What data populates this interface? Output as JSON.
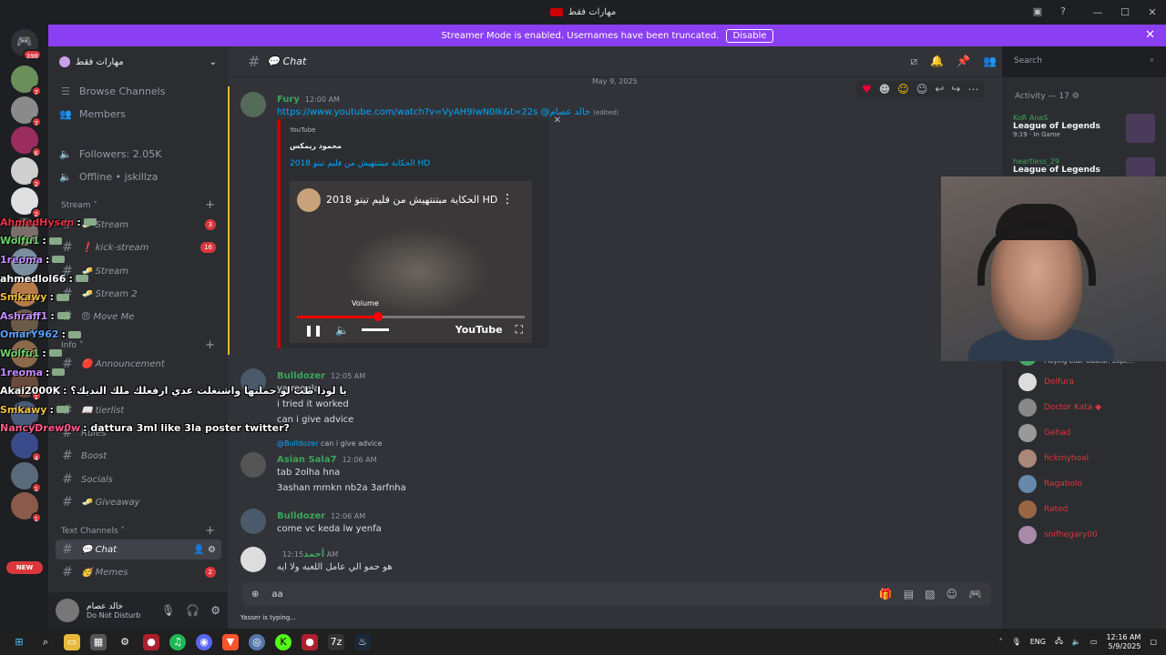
{
  "window": {
    "title": "مهارات فقط",
    "controls": [
      "—",
      "☐",
      "✕"
    ]
  },
  "banner": {
    "text": "Streamer Mode is enabled. Usernames have been truncated.",
    "disable_label": "Disable"
  },
  "guilds": {
    "home_badge": "398",
    "items": [
      {
        "badge": "7",
        "color": "#6a8f5a"
      },
      {
        "badge": "7",
        "color": "#8a8a8a"
      },
      {
        "badge": "6",
        "color": "#9b2c5e"
      },
      {
        "badge": "2",
        "color": "#cfcfcf"
      },
      {
        "badge": "2",
        "color": "#e0e0e0"
      },
      {
        "badge": "",
        "color": "#7a6f6a"
      },
      {
        "badge": "",
        "color": "#7a8fa0"
      },
      {
        "badge": "",
        "color": "#b57c4a"
      },
      {
        "badge": "",
        "color": "#6a5a4a"
      },
      {
        "badge": "",
        "color": "#8a6a4a"
      },
      {
        "badge": "1",
        "color": "#6a4a3a"
      },
      {
        "badge": "1",
        "color": "#4a5a7a"
      },
      {
        "badge": "4",
        "color": "#3a4a8a"
      },
      {
        "badge": "1",
        "color": "#5a6a7a"
      },
      {
        "badge": "1",
        "color": "#8a5a4a"
      }
    ],
    "new_label": "NEW"
  },
  "sidebar": {
    "server_name": "مهارات فقط",
    "browse": "Browse Channels",
    "members": "Members",
    "followers": "Followers: 2.05K",
    "offline": "Offline • jskillza",
    "cat_stream": "Stream ˅",
    "cat_info": "Info ˅",
    "cat_text": "Text Channels ˅",
    "channels": [
      {
        "name": "🧈 Stream",
        "count": "3"
      },
      {
        "name": "❗ kick-stream",
        "count": "16"
      },
      {
        "name": "🧈 Stream",
        "count": ""
      },
      {
        "name": "🧈 Stream 2",
        "count": ""
      },
      {
        "name": "😠 Move Me",
        "count": ""
      },
      {
        "name": "🔴 Announcement",
        "count": ""
      },
      {
        "name": "📖 tierlist",
        "count": ""
      },
      {
        "name": "Rules",
        "count": ""
      },
      {
        "name": "Boost",
        "count": ""
      },
      {
        "name": "Socials",
        "count": ""
      },
      {
        "name": "🧈 Giveaway",
        "count": ""
      },
      {
        "name": "💬 Chat",
        "count": ""
      },
      {
        "name": "🥳 Memes",
        "count": "2"
      }
    ],
    "user": {
      "name": "خالد عصام",
      "status": "Do Not Disturb"
    }
  },
  "header": {
    "channel": "💬 Chat",
    "search_placeholder": "Search"
  },
  "chat": {
    "date": "May 9, 2025",
    "messages": [
      {
        "author": "Fury",
        "time": "12:00 AM",
        "color": "#3ba55c",
        "link": "https://www.youtube.com/watch?v=VyAH9IwN0Ik&t=22s",
        "mention": "@خالد عصام",
        "edited": "(edited)"
      },
      {
        "author": "Bulldozer",
        "time": "12:05 AM",
        "color": "#3ba55c",
        "lines": [
          "ya regala",
          "i tried it worked",
          "can i give advice"
        ]
      },
      {
        "author": "Asian Sala7",
        "time": "12:06 AM",
        "color": "#3ba55c",
        "lines": [
          "tab 2olha hna",
          "3ashan mmkn nb2a 3arfnha"
        ]
      },
      {
        "author": "Bulldozer",
        "time": "12:06 AM",
        "color": "#3ba55c",
        "lines": [
          "come vc keda lw yenfa"
        ]
      },
      {
        "author": "أحمد",
        "time": "12:15 AM",
        "color": "#3ba55c",
        "lines": [
          "هو حمو الي عامل اللعبه ولا ايه"
        ]
      }
    ],
    "reply_ref": {
      "name": "@Bulldozer",
      "text": "can i give advice"
    },
    "embed": {
      "provider": "YouTube",
      "author": "محمود ريمكس",
      "title": "الحكاية مبتنتهيش من فليم تيتو 2018 HD",
      "video_title": "الحكاية مبتنتهيش من فليم تيتو 2018 HD",
      "volume_label": "Volume",
      "yt_label": "YouTube",
      "progress": 0.35
    },
    "composer_text": "aa",
    "typing": "Yasser is typing..."
  },
  "members": {
    "activity_head": "Activity — 17 ⚙",
    "activities": [
      {
        "name": "KoR AnaS",
        "game": "League of Legends",
        "status": "9:19 · In Game"
      },
      {
        "name": "heartless_29",
        "game": "League of Legends",
        "status": ""
      }
    ],
    "list": [
      {
        "name": "Biskoo",
        "status": "mansourabuff"
      },
      {
        "name": "Cipher",
        "status": ""
      },
      {
        "name": "Darkpharaoh",
        "status": "Playing Clair Obscur: Expe..."
      },
      {
        "name": "Delfura",
        "status": ""
      },
      {
        "name": "Doctor Kata ◆",
        "status": ""
      },
      {
        "name": "Gehad",
        "status": ""
      },
      {
        "name": "fickmyhoal",
        "status": ""
      },
      {
        "name": "Ragabolo",
        "status": ""
      },
      {
        "name": "Rated",
        "status": ""
      },
      {
        "name": "soifhegary00",
        "status": ""
      }
    ]
  },
  "overlay": [
    {
      "user": "AhmedHysen",
      "color": "#e8334a",
      "msg": ":"
    },
    {
      "user": "Wolfu1",
      "color": "#6dd36d",
      "msg": ":"
    },
    {
      "user": "1reoma",
      "color": "#c58cff",
      "msg": ":"
    },
    {
      "user": "ahmedlol66",
      "color": "#ffffff",
      "msg": ":"
    },
    {
      "user": "Smkawy",
      "color": "#f0c040",
      "msg": ":"
    },
    {
      "user": "Ashraff1",
      "color": "#c58cff",
      "msg": ":"
    },
    {
      "user": "OmarY962",
      "color": "#5aa0ff",
      "msg": ":"
    },
    {
      "user": "Wolfu1",
      "color": "#6dd36d",
      "msg": ":"
    },
    {
      "user": "1reoma",
      "color": "#c58cff",
      "msg": ":"
    },
    {
      "user": "Akai2000K",
      "color": "#ffffff",
      "msg": ": يا لودا طب لو حملتها واشتغلت عدي ارفعلك ملك النديك؟"
    },
    {
      "user": "Smkawy",
      "color": "#f0c040",
      "msg": ":"
    },
    {
      "user": "NancyDrew0w",
      "color": "#ff5a8a",
      "msg": ": dattura 3ml like 3la poster twitter?"
    }
  ],
  "taskbar": {
    "lang": "ENG",
    "time": "12:16 AM",
    "date": "5/9/2025"
  }
}
